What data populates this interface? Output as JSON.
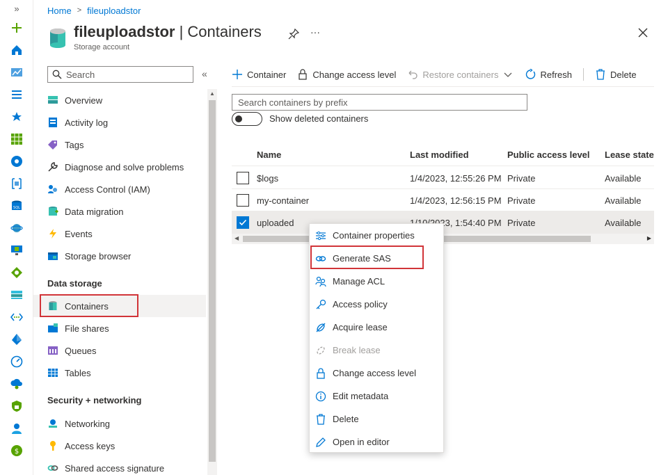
{
  "breadcrumb": {
    "home": "Home",
    "resource": "fileuploadstor"
  },
  "header": {
    "resource_name": "fileuploadstor",
    "separator": " | ",
    "page_name": "Containers",
    "subtitle": "Storage account",
    "more_label": "···"
  },
  "menu": {
    "search_placeholder": "Search",
    "collapse_label": "«",
    "items_top": [
      {
        "label": "Overview",
        "icon": "overview-icon"
      },
      {
        "label": "Activity log",
        "icon": "activity-log-icon"
      },
      {
        "label": "Tags",
        "icon": "tag-icon"
      },
      {
        "label": "Diagnose and solve problems",
        "icon": "wrench-icon"
      },
      {
        "label": "Access Control (IAM)",
        "icon": "people-icon"
      },
      {
        "label": "Data migration",
        "icon": "data-migration-icon"
      },
      {
        "label": "Events",
        "icon": "lightning-icon"
      },
      {
        "label": "Storage browser",
        "icon": "storage-browser-icon"
      }
    ],
    "section_data_storage": "Data storage",
    "items_data": [
      {
        "label": "Containers",
        "icon": "container-icon",
        "active": true
      },
      {
        "label": "File shares",
        "icon": "file-share-icon"
      },
      {
        "label": "Queues",
        "icon": "queue-icon"
      },
      {
        "label": "Tables",
        "icon": "table-icon"
      }
    ],
    "section_security": "Security + networking",
    "items_security": [
      {
        "label": "Networking",
        "icon": "networking-icon"
      },
      {
        "label": "Access keys",
        "icon": "key-icon"
      },
      {
        "label": "Shared access signature",
        "icon": "link-icon"
      }
    ]
  },
  "toolbar": {
    "add_container": "Container",
    "change_access": "Change access level",
    "restore": "Restore containers",
    "refresh": "Refresh",
    "delete": "Delete"
  },
  "search": {
    "placeholder": "Search containers by prefix"
  },
  "toggle": {
    "label": "Show deleted containers",
    "on": false
  },
  "grid": {
    "columns": [
      "Name",
      "Last modified",
      "Public access level",
      "Lease state"
    ],
    "rows": [
      {
        "name": "$logs",
        "modified": "1/4/2023, 12:55:26 PM",
        "access": "Private",
        "lease": "Available",
        "checked": false
      },
      {
        "name": "my-container",
        "modified": "1/4/2023, 12:56:15 PM",
        "access": "Private",
        "lease": "Available",
        "checked": false
      },
      {
        "name": "uploaded",
        "modified": "1/10/2023, 1:54:40 PM",
        "access": "Private",
        "lease": "Available",
        "checked": true
      }
    ]
  },
  "context_menu": [
    {
      "label": "Container properties",
      "icon": "properties-icon",
      "enabled": true
    },
    {
      "label": "Generate SAS",
      "icon": "link-icon",
      "enabled": true,
      "highlighted": true
    },
    {
      "label": "Manage ACL",
      "icon": "people-icon",
      "enabled": true
    },
    {
      "label": "Access policy",
      "icon": "key-icon",
      "enabled": true
    },
    {
      "label": "Acquire lease",
      "icon": "lease-icon",
      "enabled": true
    },
    {
      "label": "Break lease",
      "icon": "break-lease-icon",
      "enabled": false
    },
    {
      "label": "Change access level",
      "icon": "lock-icon",
      "enabled": true
    },
    {
      "label": "Edit metadata",
      "icon": "info-icon",
      "enabled": true
    },
    {
      "label": "Delete",
      "icon": "trash-icon",
      "enabled": true
    },
    {
      "label": "Open in editor",
      "icon": "pencil-icon",
      "enabled": true
    }
  ],
  "colors": {
    "accent": "#0078d4",
    "highlight_border": "#d13438",
    "disabled_text": "#a19f9d",
    "selected_row": "#edebe9"
  }
}
